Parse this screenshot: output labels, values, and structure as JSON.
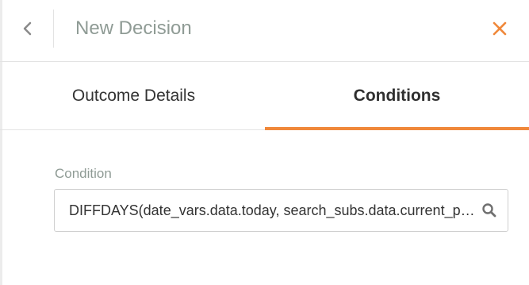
{
  "header": {
    "title": "New Decision",
    "back_icon": "chevron-left-icon",
    "close_icon": "close-icon",
    "accent_color": "#f0883a"
  },
  "tabs": [
    {
      "label": "Outcome Details",
      "active": false
    },
    {
      "label": "Conditions",
      "active": true
    }
  ],
  "condition": {
    "label": "Condition",
    "value": "DIFFDAYS(date_vars.data.today, search_subs.data.current_period_end)",
    "search_icon": "search-icon"
  }
}
